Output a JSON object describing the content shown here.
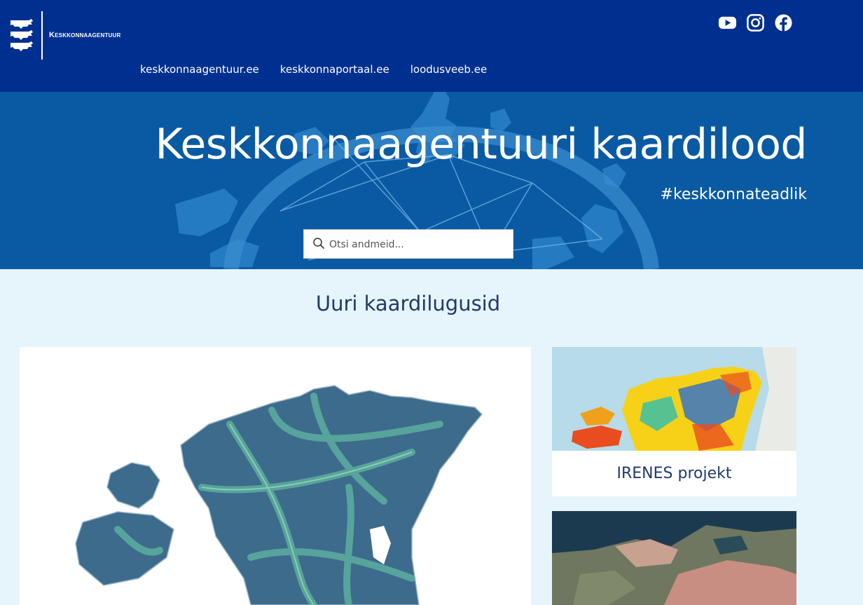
{
  "header": {
    "brand": "Keskkonnaagentuur",
    "social": [
      "youtube-icon",
      "instagram-icon",
      "facebook-icon"
    ],
    "nav": [
      "keskkonnaagentuur.ee",
      "keskkonnaportaal.ee",
      "loodusveeb.ee"
    ]
  },
  "hero": {
    "title": "Keskkonnaagentuuri kaardilood",
    "hashtag": "#keskkonnateadlik",
    "search": {
      "placeholder": "Otsi andmeid...",
      "value": ""
    }
  },
  "main": {
    "section_title": "Uuri kaardilugusid",
    "cards": [
      {
        "caption": ""
      },
      {
        "caption": "IRENES projekt"
      },
      {
        "caption": ""
      }
    ]
  },
  "colors": {
    "header_bg": "#00308f",
    "hero_bg": "#0a5aa3",
    "page_bg": "#e6f5fc",
    "heading": "#1f3a6b"
  }
}
